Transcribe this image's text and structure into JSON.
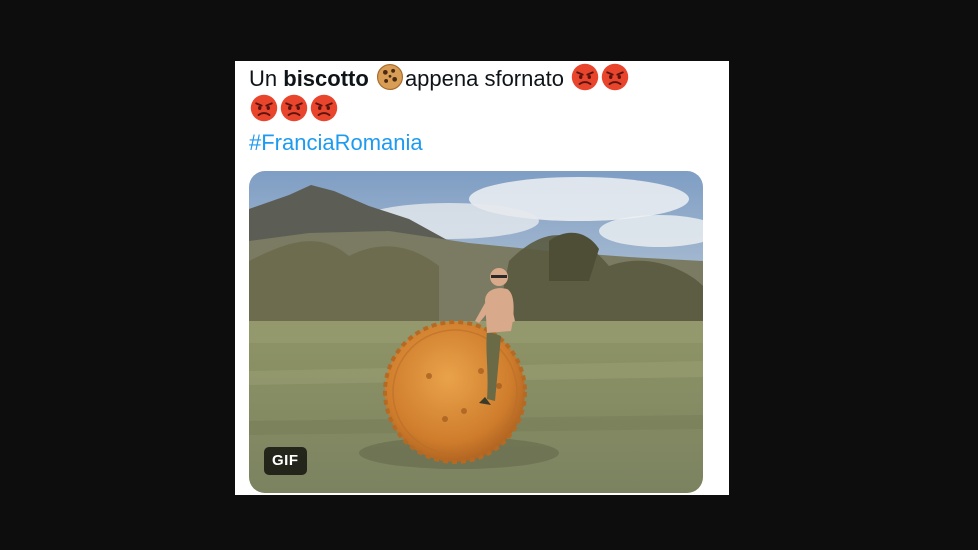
{
  "tweet": {
    "text_start": "Un ",
    "text_bold": "biscotto",
    "text_middle": "appena sfornato",
    "icons": {
      "cookie": "cookie-icon",
      "angry": "angry-face-icon"
    },
    "hashtag": "#FranciaRomania"
  },
  "media": {
    "badge": "GIF"
  },
  "colors": {
    "background": "#0d0d0d",
    "card": "#ffffff",
    "text": "#0f1419",
    "hashtag": "#1d9bf0"
  }
}
